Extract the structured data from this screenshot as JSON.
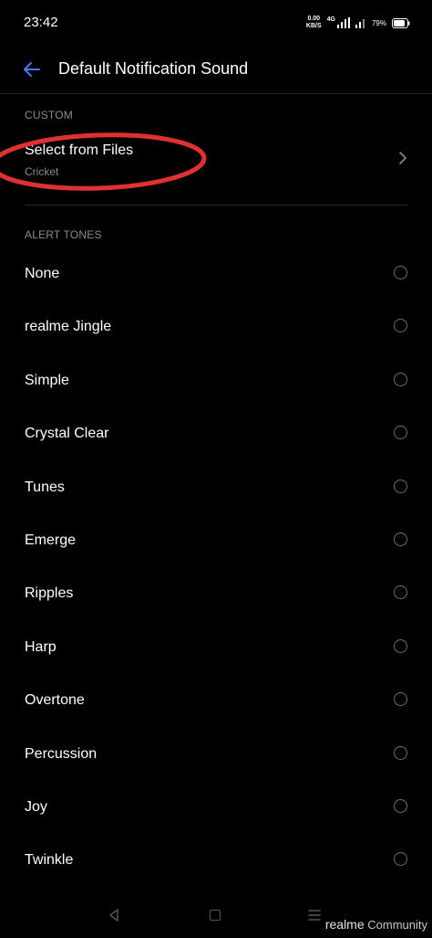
{
  "status_bar": {
    "time": "23:42",
    "net_speed_value": "0.00",
    "net_speed_unit": "KB/S",
    "network_type": "4G",
    "battery": "79%"
  },
  "header": {
    "title": "Default Notification Sound"
  },
  "custom_section": {
    "header": "CUSTOM",
    "item": {
      "title": "Select from Files",
      "subtitle": "Cricket"
    }
  },
  "alert_section": {
    "header": "ALERT TONES",
    "tones": [
      {
        "label": "None",
        "selected": false
      },
      {
        "label": "realme Jingle",
        "selected": false
      },
      {
        "label": "Simple",
        "selected": false
      },
      {
        "label": "Crystal Clear",
        "selected": false
      },
      {
        "label": "Tunes",
        "selected": false
      },
      {
        "label": "Emerge",
        "selected": false
      },
      {
        "label": "Ripples",
        "selected": false
      },
      {
        "label": "Harp",
        "selected": false
      },
      {
        "label": "Overtone",
        "selected": false
      },
      {
        "label": "Percussion",
        "selected": false
      },
      {
        "label": "Joy",
        "selected": false
      },
      {
        "label": "Twinkle",
        "selected": false
      }
    ]
  },
  "watermark": {
    "brand": "realme",
    "suffix": "Community"
  },
  "colors": {
    "accent": "#4a7bf7",
    "annotation": "#e03131",
    "background": "#000000",
    "secondary_text": "#8a8a8a"
  },
  "icons": {
    "back": "arrow-left-icon",
    "chevron": "chevron-right-icon",
    "radio": "radio-unchecked-icon"
  }
}
